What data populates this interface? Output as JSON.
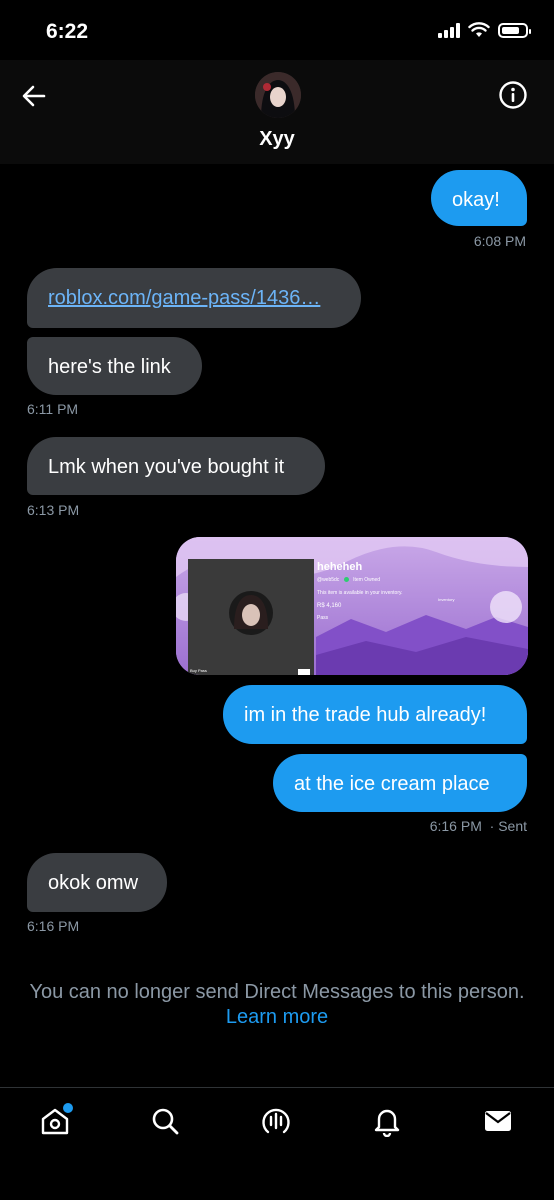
{
  "status": {
    "time": "6:22"
  },
  "header": {
    "name": "Xyy"
  },
  "messages": {
    "m1": "okay!",
    "t1": "6:08 PM",
    "m2": "roblox.com/game-pass/1436…",
    "m3": "here's the link",
    "t3": "6:11 PM",
    "m4": "Lmk when you've bought it",
    "t4": "6:13 PM",
    "card": {
      "title": "heheheh",
      "meta1": "@web5dc",
      "meta2": "Item Owned",
      "line1": "This item is available in your inventory.",
      "line2": "Inventory",
      "price": "R$ 4,160",
      "pass": "Pass",
      "foot": "Buy Pass"
    },
    "m5": "im in the trade hub already!",
    "m6": "at the ice cream place",
    "t6": "6:16 PM",
    "t6_status": "· Sent",
    "m7": "okok omw",
    "t7": "6:16 PM"
  },
  "notice": {
    "text": "You can no longer send Direct Messages to this person.",
    "link": "Learn more"
  },
  "colors": {
    "accent": "#1d9bf0",
    "incoming": "#3a3d41",
    "background": "#000000"
  },
  "nav": {
    "icons": [
      "home-icon",
      "search-icon",
      "spaces-icon",
      "notifications-icon",
      "messages-icon"
    ]
  }
}
